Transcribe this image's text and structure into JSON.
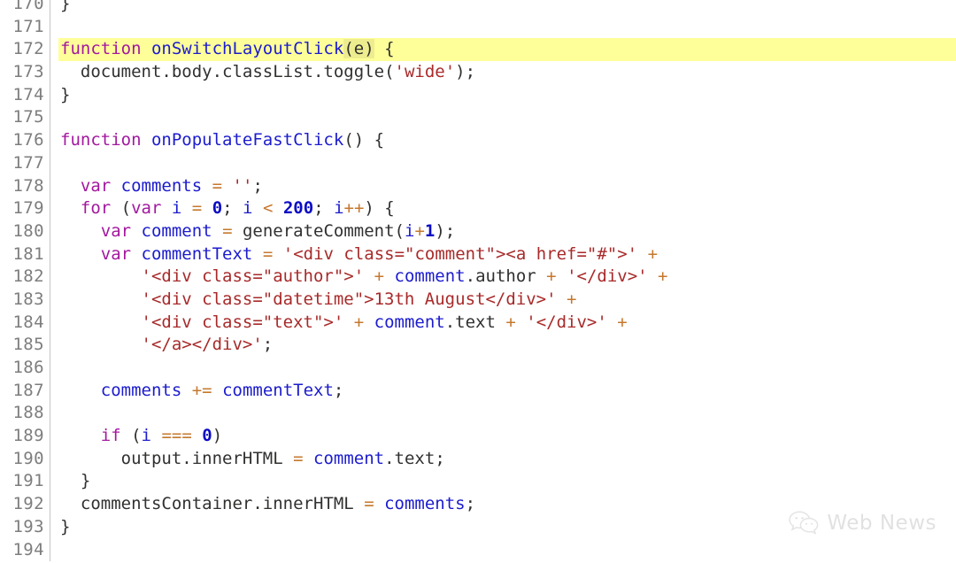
{
  "editor": {
    "language": "javascript",
    "background_color": "#ffffff",
    "gutter_color": "#7d7d7d",
    "current_line_number": 172,
    "current_line_highlight_color": "#ffff99",
    "first_visible_line": 170,
    "last_visible_line": 194,
    "tab_size": 2
  },
  "syntax_colors": {
    "keyword": "#a3189f",
    "identifier": "#1c1ccd",
    "string": "#a82a2a",
    "number": "#0b0bc4",
    "operator": "#c5782e",
    "plain": "#30302f",
    "match_highlight": "#eded8f"
  },
  "gutter": {
    "numbers": [
      "170",
      "171",
      "172",
      "173",
      "174",
      "175",
      "176",
      "177",
      "178",
      "179",
      "180",
      "181",
      "182",
      "183",
      "184",
      "185",
      "186",
      "187",
      "188",
      "189",
      "190",
      "191",
      "192",
      "193",
      "194"
    ]
  },
  "lines": [
    {
      "n": "170",
      "current": false,
      "tokens": [
        {
          "t": "}",
          "c": "tok-pl"
        }
      ]
    },
    {
      "n": "171",
      "current": false,
      "tokens": []
    },
    {
      "n": "172",
      "current": true,
      "tokens": [
        {
          "t": "function",
          "c": "tok-kw"
        },
        {
          "t": " ",
          "c": "tok-pl"
        },
        {
          "t": "onSwitchLayoutClick",
          "c": "tok-id"
        },
        {
          "t": "(e)",
          "c": "tok-pl",
          "match": true
        },
        {
          "t": " {",
          "c": "tok-pl"
        }
      ]
    },
    {
      "n": "173",
      "current": false,
      "tokens": [
        {
          "t": "  document",
          "c": "tok-pl"
        },
        {
          "t": ".body",
          "c": "tok-prop"
        },
        {
          "t": ".classList",
          "c": "tok-prop"
        },
        {
          "t": ".toggle",
          "c": "tok-prop"
        },
        {
          "t": "(",
          "c": "tok-pl"
        },
        {
          "t": "'wide'",
          "c": "tok-str"
        },
        {
          "t": ");",
          "c": "tok-pl"
        }
      ]
    },
    {
      "n": "174",
      "current": false,
      "tokens": [
        {
          "t": "}",
          "c": "tok-pl"
        }
      ]
    },
    {
      "n": "175",
      "current": false,
      "tokens": []
    },
    {
      "n": "176",
      "current": false,
      "tokens": [
        {
          "t": "function",
          "c": "tok-kw"
        },
        {
          "t": " ",
          "c": "tok-pl"
        },
        {
          "t": "onPopulateFastClick",
          "c": "tok-id"
        },
        {
          "t": "() {",
          "c": "tok-pl"
        }
      ]
    },
    {
      "n": "177",
      "current": false,
      "tokens": []
    },
    {
      "n": "178",
      "current": false,
      "tokens": [
        {
          "t": "  ",
          "c": "tok-pl"
        },
        {
          "t": "var",
          "c": "tok-kw"
        },
        {
          "t": " ",
          "c": "tok-pl"
        },
        {
          "t": "comments",
          "c": "tok-id"
        },
        {
          "t": " ",
          "c": "tok-pl"
        },
        {
          "t": "=",
          "c": "tok-op"
        },
        {
          "t": " ",
          "c": "tok-pl"
        },
        {
          "t": "''",
          "c": "tok-str"
        },
        {
          "t": ";",
          "c": "tok-pl"
        }
      ]
    },
    {
      "n": "179",
      "current": false,
      "tokens": [
        {
          "t": "  ",
          "c": "tok-pl"
        },
        {
          "t": "for",
          "c": "tok-kw"
        },
        {
          "t": " (",
          "c": "tok-pl"
        },
        {
          "t": "var",
          "c": "tok-kw"
        },
        {
          "t": " ",
          "c": "tok-pl"
        },
        {
          "t": "i",
          "c": "tok-id"
        },
        {
          "t": " ",
          "c": "tok-pl"
        },
        {
          "t": "=",
          "c": "tok-op"
        },
        {
          "t": " ",
          "c": "tok-pl"
        },
        {
          "t": "0",
          "c": "tok-num"
        },
        {
          "t": "; ",
          "c": "tok-pl"
        },
        {
          "t": "i",
          "c": "tok-id"
        },
        {
          "t": " ",
          "c": "tok-pl"
        },
        {
          "t": "<",
          "c": "tok-op"
        },
        {
          "t": " ",
          "c": "tok-pl"
        },
        {
          "t": "200",
          "c": "tok-num"
        },
        {
          "t": "; ",
          "c": "tok-pl"
        },
        {
          "t": "i",
          "c": "tok-id"
        },
        {
          "t": "++",
          "c": "tok-op"
        },
        {
          "t": ") {",
          "c": "tok-pl"
        }
      ]
    },
    {
      "n": "180",
      "current": false,
      "tokens": [
        {
          "t": "    ",
          "c": "tok-pl"
        },
        {
          "t": "var",
          "c": "tok-kw"
        },
        {
          "t": " ",
          "c": "tok-pl"
        },
        {
          "t": "comment",
          "c": "tok-id"
        },
        {
          "t": " ",
          "c": "tok-pl"
        },
        {
          "t": "=",
          "c": "tok-op"
        },
        {
          "t": " generateComment(",
          "c": "tok-pl"
        },
        {
          "t": "i",
          "c": "tok-id"
        },
        {
          "t": "+",
          "c": "tok-op"
        },
        {
          "t": "1",
          "c": "tok-num"
        },
        {
          "t": ");",
          "c": "tok-pl"
        }
      ]
    },
    {
      "n": "181",
      "current": false,
      "tokens": [
        {
          "t": "    ",
          "c": "tok-pl"
        },
        {
          "t": "var",
          "c": "tok-kw"
        },
        {
          "t": " ",
          "c": "tok-pl"
        },
        {
          "t": "commentText",
          "c": "tok-id"
        },
        {
          "t": " ",
          "c": "tok-pl"
        },
        {
          "t": "=",
          "c": "tok-op"
        },
        {
          "t": " ",
          "c": "tok-pl"
        },
        {
          "t": "'<div class=\"comment\"><a href=\"#\">'",
          "c": "tok-str"
        },
        {
          "t": " ",
          "c": "tok-pl"
        },
        {
          "t": "+",
          "c": "tok-op"
        }
      ]
    },
    {
      "n": "182",
      "current": false,
      "tokens": [
        {
          "t": "        ",
          "c": "tok-pl"
        },
        {
          "t": "'<div class=\"author\">'",
          "c": "tok-str"
        },
        {
          "t": " ",
          "c": "tok-pl"
        },
        {
          "t": "+",
          "c": "tok-op"
        },
        {
          "t": " ",
          "c": "tok-pl"
        },
        {
          "t": "comment",
          "c": "tok-id"
        },
        {
          "t": ".author",
          "c": "tok-prop"
        },
        {
          "t": " ",
          "c": "tok-pl"
        },
        {
          "t": "+",
          "c": "tok-op"
        },
        {
          "t": " ",
          "c": "tok-pl"
        },
        {
          "t": "'</div>'",
          "c": "tok-str"
        },
        {
          "t": " ",
          "c": "tok-pl"
        },
        {
          "t": "+",
          "c": "tok-op"
        }
      ]
    },
    {
      "n": "183",
      "current": false,
      "tokens": [
        {
          "t": "        ",
          "c": "tok-pl"
        },
        {
          "t": "'<div class=\"datetime\">13th August</div>'",
          "c": "tok-str"
        },
        {
          "t": " ",
          "c": "tok-pl"
        },
        {
          "t": "+",
          "c": "tok-op"
        }
      ]
    },
    {
      "n": "184",
      "current": false,
      "tokens": [
        {
          "t": "        ",
          "c": "tok-pl"
        },
        {
          "t": "'<div class=\"text\">'",
          "c": "tok-str"
        },
        {
          "t": " ",
          "c": "tok-pl"
        },
        {
          "t": "+",
          "c": "tok-op"
        },
        {
          "t": " ",
          "c": "tok-pl"
        },
        {
          "t": "comment",
          "c": "tok-id"
        },
        {
          "t": ".text",
          "c": "tok-prop"
        },
        {
          "t": " ",
          "c": "tok-pl"
        },
        {
          "t": "+",
          "c": "tok-op"
        },
        {
          "t": " ",
          "c": "tok-pl"
        },
        {
          "t": "'</div>'",
          "c": "tok-str"
        },
        {
          "t": " ",
          "c": "tok-pl"
        },
        {
          "t": "+",
          "c": "tok-op"
        }
      ]
    },
    {
      "n": "185",
      "current": false,
      "tokens": [
        {
          "t": "        ",
          "c": "tok-pl"
        },
        {
          "t": "'</a></div>'",
          "c": "tok-str"
        },
        {
          "t": ";",
          "c": "tok-pl"
        }
      ]
    },
    {
      "n": "186",
      "current": false,
      "tokens": []
    },
    {
      "n": "187",
      "current": false,
      "tokens": [
        {
          "t": "    ",
          "c": "tok-pl"
        },
        {
          "t": "comments",
          "c": "tok-id"
        },
        {
          "t": " ",
          "c": "tok-pl"
        },
        {
          "t": "+=",
          "c": "tok-op"
        },
        {
          "t": " ",
          "c": "tok-pl"
        },
        {
          "t": "commentText",
          "c": "tok-id"
        },
        {
          "t": ";",
          "c": "tok-pl"
        }
      ]
    },
    {
      "n": "188",
      "current": false,
      "tokens": []
    },
    {
      "n": "189",
      "current": false,
      "tokens": [
        {
          "t": "    ",
          "c": "tok-pl"
        },
        {
          "t": "if",
          "c": "tok-kw"
        },
        {
          "t": " (",
          "c": "tok-pl"
        },
        {
          "t": "i",
          "c": "tok-id"
        },
        {
          "t": " ",
          "c": "tok-pl"
        },
        {
          "t": "===",
          "c": "tok-op"
        },
        {
          "t": " ",
          "c": "tok-pl"
        },
        {
          "t": "0",
          "c": "tok-num"
        },
        {
          "t": ")",
          "c": "tok-pl"
        }
      ]
    },
    {
      "n": "190",
      "current": false,
      "tokens": [
        {
          "t": "      output",
          "c": "tok-pl"
        },
        {
          "t": ".innerHTML",
          "c": "tok-prop"
        },
        {
          "t": " ",
          "c": "tok-pl"
        },
        {
          "t": "=",
          "c": "tok-op"
        },
        {
          "t": " ",
          "c": "tok-pl"
        },
        {
          "t": "comment",
          "c": "tok-id"
        },
        {
          "t": ".text",
          "c": "tok-prop"
        },
        {
          "t": ";",
          "c": "tok-pl"
        }
      ]
    },
    {
      "n": "191",
      "current": false,
      "tokens": [
        {
          "t": "  }",
          "c": "tok-pl"
        }
      ]
    },
    {
      "n": "192",
      "current": false,
      "tokens": [
        {
          "t": "  commentsContainer",
          "c": "tok-pl"
        },
        {
          "t": ".innerHTML",
          "c": "tok-prop"
        },
        {
          "t": " ",
          "c": "tok-pl"
        },
        {
          "t": "=",
          "c": "tok-op"
        },
        {
          "t": " ",
          "c": "tok-pl"
        },
        {
          "t": "comments",
          "c": "tok-id"
        },
        {
          "t": ";",
          "c": "tok-pl"
        }
      ]
    },
    {
      "n": "193",
      "current": false,
      "tokens": [
        {
          "t": "}",
          "c": "tok-pl"
        }
      ]
    },
    {
      "n": "194",
      "current": false,
      "tokens": []
    }
  ],
  "watermark": {
    "icon": "wechat-logo-icon",
    "text": "Web News",
    "color": "#c9c9c9"
  }
}
